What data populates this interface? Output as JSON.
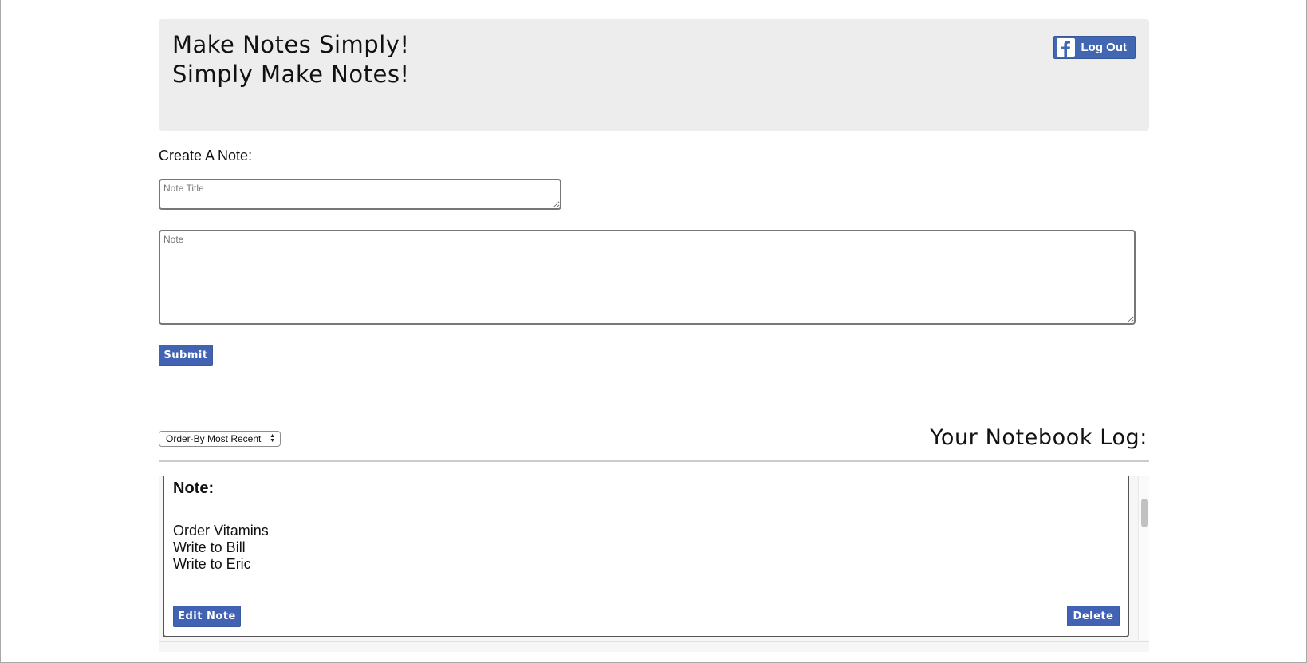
{
  "header": {
    "title_line1": "Make Notes Simply!",
    "title_line2": "Simply Make Notes!",
    "logout_label": "Log Out"
  },
  "create": {
    "label": "Create A Note:",
    "title_placeholder": "Note Title",
    "note_placeholder": "Note",
    "submit_label": "Submit"
  },
  "log": {
    "order_select_value": "Order-By Most Recent",
    "title": "Your Notebook Log:",
    "notes": [
      {
        "heading": "Note:",
        "lines": [
          "Order Vitamins",
          "Write to Bill",
          "Write to Eric"
        ],
        "edit_label": "Edit Note",
        "delete_label": "Delete"
      }
    ]
  },
  "colors": {
    "button_blue": "#4263b3",
    "facebook_blue": "#4267b2",
    "header_bg": "#ededed"
  }
}
